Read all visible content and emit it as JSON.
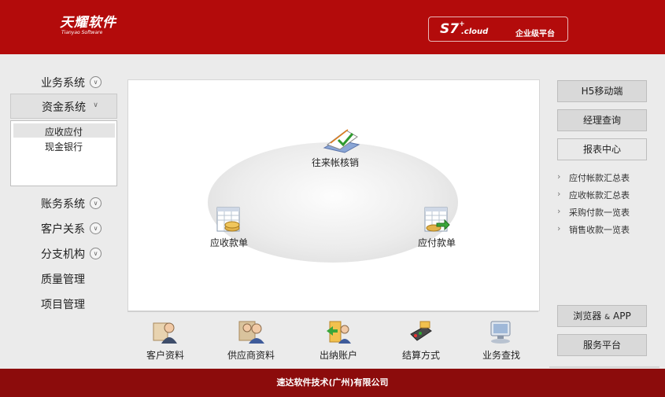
{
  "header": {
    "logo_text": "天耀软件",
    "logo_subtitle": "Tianyao Software",
    "product_name": "S7",
    "product_superscript": "+",
    "product_suffix": ".cloud",
    "platform_label": "企业级平台"
  },
  "left_nav": {
    "items": [
      {
        "label": "业务系统",
        "icon": "chevron-down-circle"
      },
      {
        "label": "资金系统",
        "icon": "chevron-down"
      },
      {
        "label": "账务系统",
        "icon": "chevron-down-circle"
      },
      {
        "label": "客户关系",
        "icon": "chevron-down-circle"
      },
      {
        "label": "分支机构",
        "icon": "chevron-down-circle"
      },
      {
        "label": "质量管理"
      },
      {
        "label": "项目管理"
      }
    ],
    "submenu": [
      {
        "label": "应收应付",
        "selected": true
      },
      {
        "label": "现金银行",
        "selected": false
      }
    ]
  },
  "flow": {
    "nodes": [
      {
        "label": "往来帐核销",
        "icon": "ledger-check-icon"
      },
      {
        "label": "应收款单",
        "icon": "receivable-sheet-icon"
      },
      {
        "label": "应付款单",
        "icon": "payable-sheet-icon"
      }
    ]
  },
  "bottom_bar": {
    "items": [
      {
        "label": "客户资料",
        "icon": "customer-profile-icon"
      },
      {
        "label": "供应商资料",
        "icon": "supplier-profile-icon"
      },
      {
        "label": "出纳账户",
        "icon": "cashier-account-icon"
      },
      {
        "label": "结算方式",
        "icon": "settlement-method-icon"
      },
      {
        "label": "业务查找",
        "icon": "business-search-icon"
      }
    ]
  },
  "right_panel": {
    "buttons": [
      "H5移动端",
      "经理查询",
      "报表中心"
    ],
    "reports": [
      "应付帐款汇总表",
      "应收帐款汇总表",
      "采购付款一览表",
      "销售收款一览表"
    ],
    "browser_app_label": "浏览器",
    "browser_app_amp": "&",
    "browser_app_suffix": "APP",
    "service_platform_label": "服务平台"
  },
  "footer": {
    "company": "速达软件技术(广州)有限公司"
  },
  "colors": {
    "header_red": "#b30b0b",
    "footer_red": "#8c0c0c",
    "background": "#ebebeb"
  }
}
